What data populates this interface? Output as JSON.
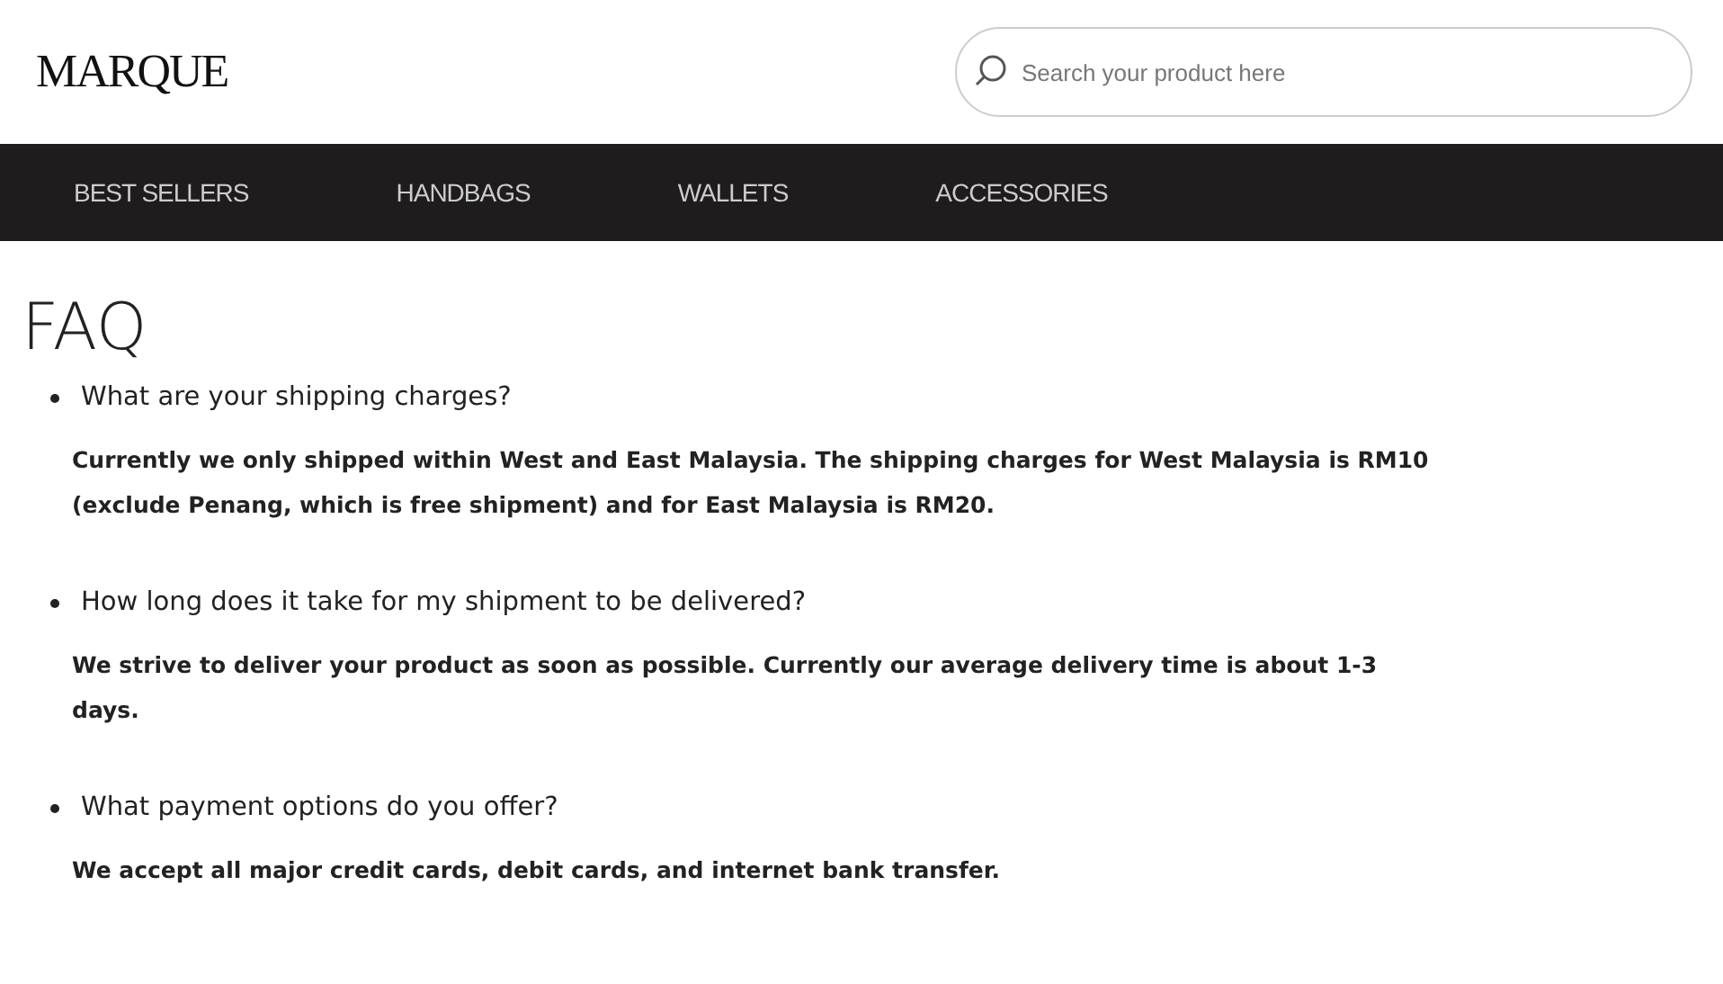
{
  "header": {
    "logo": "MARQUE",
    "search": {
      "placeholder": "Search your product here"
    }
  },
  "nav": [
    {
      "label": "BEST SELLERS"
    },
    {
      "label": "HANDBAGS"
    },
    {
      "label": "WALLETS"
    },
    {
      "label": "ACCESSORIES"
    }
  ],
  "title": "FAQ",
  "faqs": [
    {
      "question": "What are your shipping charges?",
      "answer": "Currently we only shipped within West and East Malaysia. The shipping charges for West Malaysia is RM10 (exclude Penang, which is free shipment) and for East Malaysia is RM20."
    },
    {
      "question": "How long does it take for my shipment to be delivered?",
      "answer": "We strive to deliver your product as soon as possible. Currently our average delivery time is about 1-3 days."
    },
    {
      "question": "What payment options do you offer?",
      "answer": "We accept all major credit cards, debit cards, and internet bank transfer."
    }
  ]
}
